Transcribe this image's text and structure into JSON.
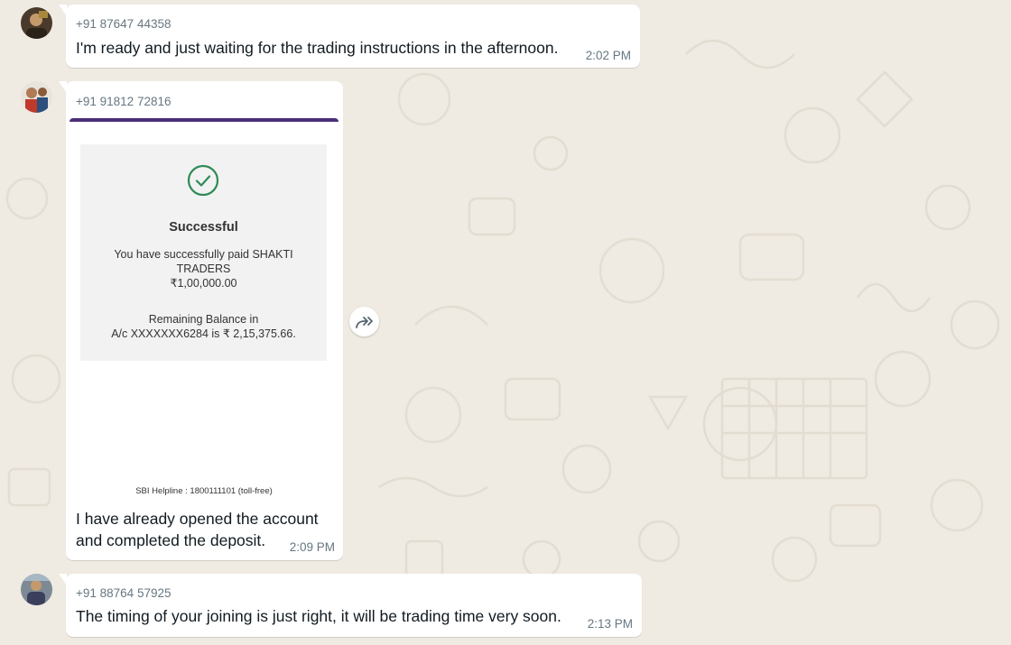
{
  "theme": {
    "chat_bg": "#efeae2",
    "bubble_bg": "#ffffff",
    "meta_text": "#667781",
    "body_text": "#111b21",
    "success_green": "#2e8b57",
    "receipt_accent": "#4a2d7a"
  },
  "messages": [
    {
      "sender": "+91 87647 44358",
      "text": "I'm ready and just waiting for the trading instructions in the afternoon.",
      "time": "2:02 PM",
      "avatar_icon": "contact-avatar"
    },
    {
      "sender": "+91 91812 72816",
      "avatar_icon": "contact-avatar",
      "receipt": {
        "status_icon": "check-circle-icon",
        "title": "Successful",
        "line1": "You have successfully paid SHAKTI",
        "line2": "TRADERS",
        "amount": "₹1,00,000.00",
        "balance_line1": "Remaining Balance in",
        "balance_line2": "A/c XXXXXXX6284 is ₹ 2,15,375.66.",
        "helpline": "SBI Helpline : 1800111101 (toll-free)"
      },
      "text_line1": "I have already opened the account",
      "text_line2": "and completed the deposit.",
      "time": "2:09 PM",
      "forward_icon": "forward-icon"
    },
    {
      "sender": "+91 88764 57925",
      "text": "The timing of your joining is just right, it will be trading time very soon.",
      "time": "2:13 PM",
      "avatar_icon": "contact-avatar"
    }
  ]
}
